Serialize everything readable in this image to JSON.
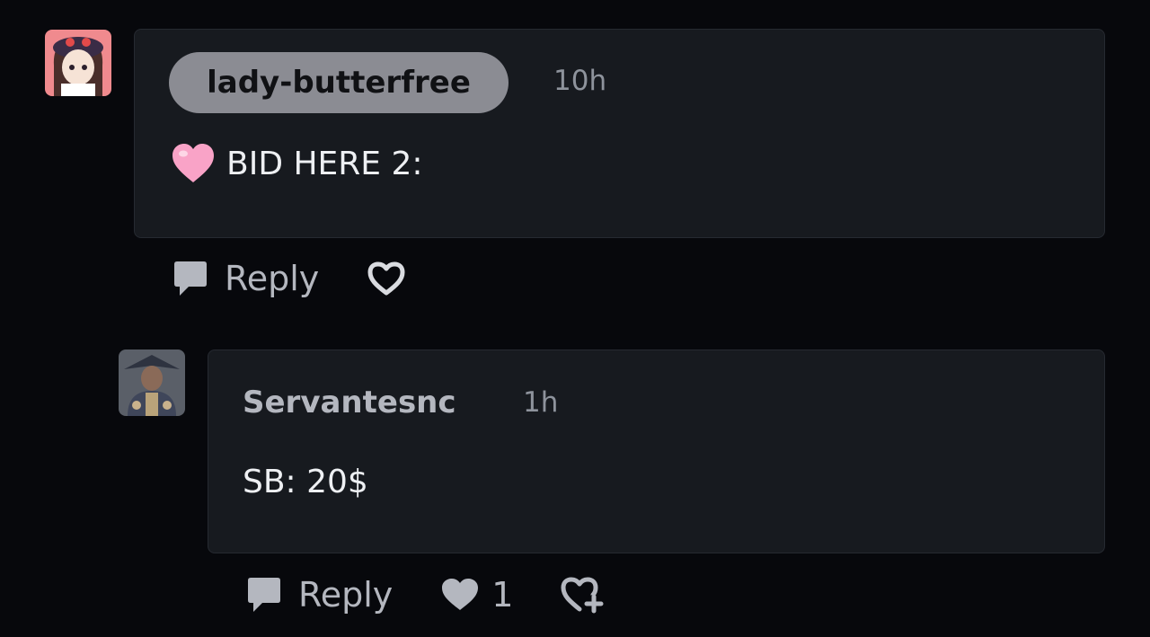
{
  "comments": [
    {
      "username": "lady-butterfree",
      "time": "10h",
      "emoji": "pink-heart",
      "text": "BID HERE 2:",
      "actions": {
        "reply_label": "Reply",
        "liked": false
      }
    },
    {
      "username": "Servantesnc",
      "time": "1h",
      "text": "SB: 20$",
      "actions": {
        "reply_label": "Reply",
        "liked": true,
        "like_count": "1"
      }
    }
  ],
  "colors": {
    "background": "#07080c",
    "card": "#171a1f",
    "pill": "#8b8c93",
    "muted": "#b4b7bf"
  }
}
